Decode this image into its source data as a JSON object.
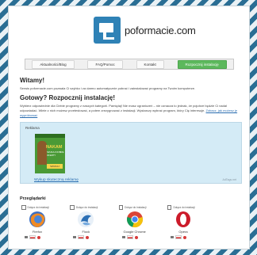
{
  "site": {
    "name": "poformacie.com"
  },
  "nav": {
    "items": [
      {
        "label": "Aktualności/Blog"
      },
      {
        "label": "FAQ/Pomoc"
      },
      {
        "label": "Kontakt"
      },
      {
        "label": "Rozpocznij instalację"
      }
    ]
  },
  "welcome": {
    "heading": "Witamy!",
    "body": "Serwis poformacie.com pozwala Ci szybko i za darmo automatycznie pobrać i zainstalować programy na Twoim komputerze."
  },
  "ready": {
    "heading": "Gotowy? Rozpocznij instalację!",
    "body": "Wybierz odpowiednie dla Ciebie programy z naszych kategorii. Pamiętaj! Nie masz ograniczeń – nie oznacza to jednak, że pojutrze będzie Ci nadal odpowiadać. Wiele z nich możesz przetestować, a potem zrezygnować z instalacji. Wystarczy wybrać program, który Cię interesuje. ",
    "link": "Zobacz, jak możesz je wypróbować"
  },
  "ad": {
    "label": "Reklama",
    "banner_title": "NAKAM",
    "banner_sub": "SZUKAJ DOBRE OFERTY",
    "banner_btn": "SZUKAJ",
    "link": "Wykup skuteczną reklamę",
    "tag": "AdTags.net"
  },
  "browsers": {
    "heading": "Przeglądarki",
    "checkbox_label": "Dołącz do instalacji",
    "items": [
      {
        "name": "Firefox",
        "icon": "firefox-icon"
      },
      {
        "name": "Flock",
        "icon": "flock-icon"
      },
      {
        "name": "Google Chrome",
        "icon": "chrome-icon"
      },
      {
        "name": "Opera",
        "icon": "opera-icon"
      }
    ]
  },
  "colors": {
    "brand_blue": "#2f82b6",
    "nav_active": "#5cb85c",
    "ad_bg": "#d4ebf6",
    "link": "#2a6db0"
  }
}
